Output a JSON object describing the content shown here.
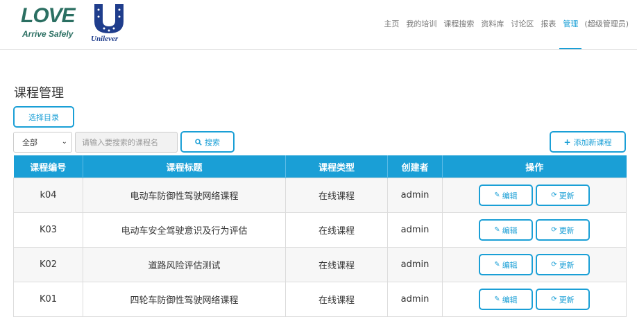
{
  "brand": {
    "love": "LOVE",
    "love_sub": "Arrive Safely",
    "unilever": "Unilever"
  },
  "nav": {
    "items": [
      {
        "label": "主页"
      },
      {
        "label": "我的培训"
      },
      {
        "label": "课程搜索"
      },
      {
        "label": "资料库"
      },
      {
        "label": "讨论区"
      },
      {
        "label": "报表"
      },
      {
        "label": "管理"
      }
    ],
    "active": "管理",
    "role": "(超级管理员)"
  },
  "page": {
    "title": "课程管理"
  },
  "toolbar": {
    "select_dir_label": "选择目录",
    "filter_value": "全部",
    "search_placeholder": "请输入要搜索的课程名",
    "search_label": "搜索",
    "add_label": "添加新课程"
  },
  "table": {
    "columns": [
      "课程编号",
      "课程标题",
      "课程类型",
      "创建者",
      "操作"
    ],
    "rows": [
      {
        "code": "k04",
        "title": "电动车防御性驾驶网络课程",
        "type": "在线课程",
        "creator": "admin"
      },
      {
        "code": "K03",
        "title": "电动车安全驾驶意识及行为评估",
        "type": "在线课程",
        "creator": "admin"
      },
      {
        "code": "K02",
        "title": "道路风险评估测试",
        "type": "在线课程",
        "creator": "admin"
      },
      {
        "code": "K01",
        "title": "四轮车防御性驾驶网络课程",
        "type": "在线课程",
        "creator": "admin"
      }
    ],
    "edit_label": "编辑",
    "update_label": "更新"
  },
  "colors": {
    "accent": "#1a9fd6",
    "brand_green": "#2b6f62",
    "unilever_blue": "#1f3d8c"
  },
  "icons": [
    "search-icon",
    "plus-icon",
    "pencil-icon",
    "refresh-icon",
    "chevron-down-icon"
  ]
}
